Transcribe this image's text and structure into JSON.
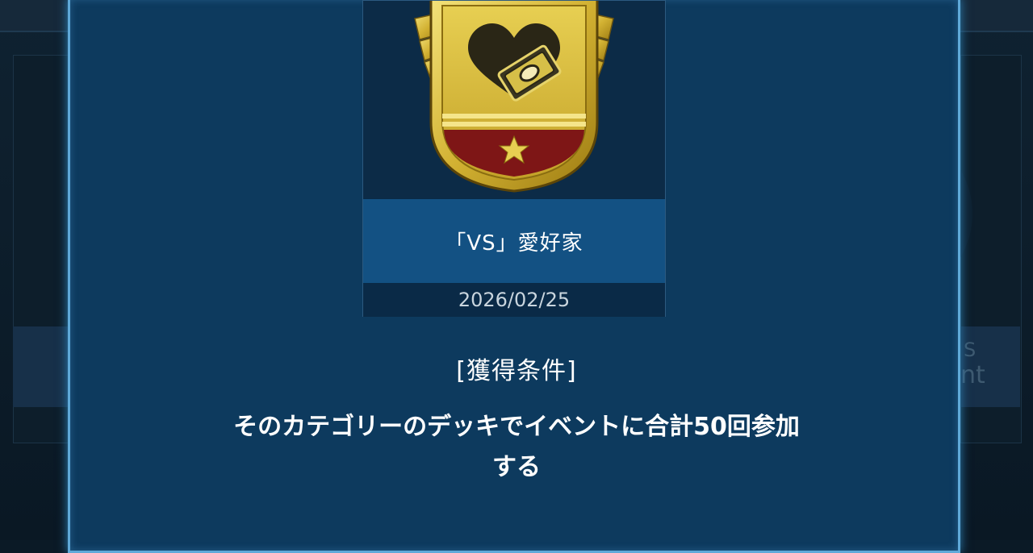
{
  "background": {
    "right_fragment_top": "S",
    "right_fragment_bottom": "nt"
  },
  "badge": {
    "icon": "heart-card-emblem-icon",
    "title": "「VS」愛好家",
    "date": "2026/02/25"
  },
  "condition": {
    "heading": "[獲得条件]",
    "text_line1": "そのカテゴリーのデッキでイベントに合計50回参加",
    "text_line2": "する"
  },
  "colors": {
    "modal_bg": "#0d3a5e",
    "modal_border": "#5fa9d8",
    "title_bar": "#135183",
    "gold": "#d8b93a",
    "crimson": "#8a1a1a"
  }
}
